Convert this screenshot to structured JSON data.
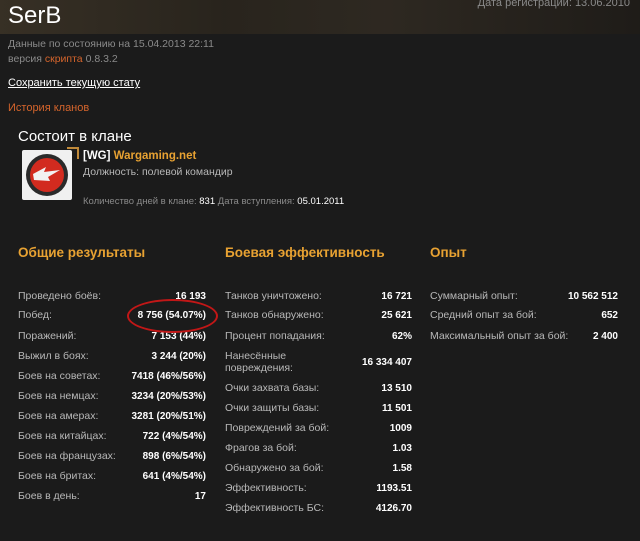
{
  "profile": {
    "username": "SerB",
    "registration": "Дата регистрации: 13.06.2010",
    "data_date": "Данные по состоянию на 15.04.2013 22:11",
    "version_prefix": "версия",
    "version_link": "скрипта",
    "version_num": "0.8.3.2",
    "save_link": "Сохранить текущую стату",
    "history_link": "История кланов"
  },
  "clan": {
    "section_title": "Состоит в клане",
    "tag": "[WG]",
    "name": "Wargaming.net",
    "role": "Должность: полевой командир",
    "days_label": "Количество дней в клане:",
    "days_value": "831",
    "join_label": "Дата вступления:",
    "join_value": "05.01.2011"
  },
  "general": {
    "title": "Общие результаты",
    "rows": [
      {
        "label": "Проведено боёв:",
        "value": "16 193"
      },
      {
        "label": "Побед:",
        "value": "8 756 (54.07%)"
      },
      {
        "label": "Поражений:",
        "value": "7 153 (44%)"
      },
      {
        "label": "Выжил в боях:",
        "value": "3 244 (20%)"
      },
      {
        "label": "Боев на советах:",
        "value": "7418 (46%/56%)"
      },
      {
        "label": "Боев на немцах:",
        "value": "3234 (20%/53%)"
      },
      {
        "label": "Боев на амерах:",
        "value": "3281 (20%/51%)"
      },
      {
        "label": "Боев на китайцах:",
        "value": "722 (4%/54%)"
      },
      {
        "label": "Боев на французах:",
        "value": "898 (6%/54%)"
      },
      {
        "label": "Боев на бритах:",
        "value": "641 (4%/54%)"
      },
      {
        "label": "Боев в день:",
        "value": "17"
      }
    ]
  },
  "battle": {
    "title": "Боевая эффективность",
    "rows": [
      {
        "label": "Танков уничтожено:",
        "value": "16 721"
      },
      {
        "label": "Танков обнаружено:",
        "value": "25 621"
      },
      {
        "label": "Процент попадания:",
        "value": "62%"
      },
      {
        "label": "Нанесённые",
        "label2": "повреждения:",
        "value": "16 334 407"
      },
      {
        "label": "Очки захвата базы:",
        "value": "13 510"
      },
      {
        "label": "Очки защиты базы:",
        "value": "11 501"
      },
      {
        "label": "Повреждений за бой:",
        "value": "1009"
      },
      {
        "label": "Фрагов за бой:",
        "value": "1.03"
      },
      {
        "label": "Обнаружено за бой:",
        "value": "1.58"
      },
      {
        "label": "Эффективность:",
        "value": "1193.51"
      },
      {
        "label": "Эффективность БС:",
        "value": "4126.70"
      }
    ]
  },
  "experience": {
    "title": "Опыт",
    "rows": [
      {
        "label": "Суммарный опыт:",
        "value": "10 562 512"
      },
      {
        "label": "Средний опыт за бой:",
        "value": "652"
      },
      {
        "label": "Максимальный опыт за бой:",
        "value": "2 400"
      }
    ]
  }
}
